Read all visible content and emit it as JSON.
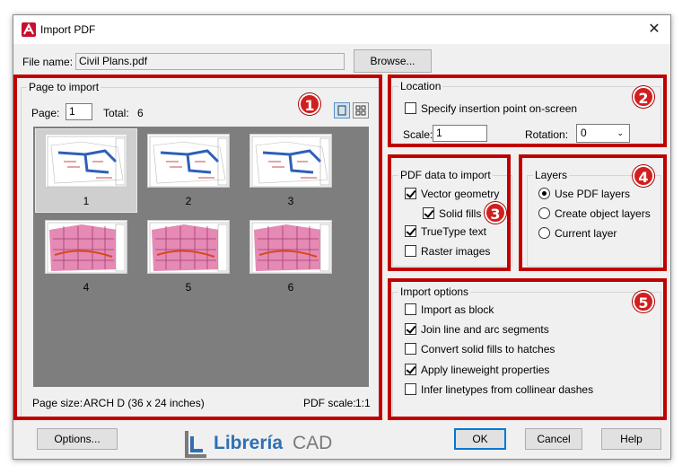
{
  "window": {
    "title": "Import PDF",
    "close_glyph": "✕"
  },
  "file": {
    "label": "File name:",
    "value": "Civil Plans.pdf",
    "browse": "Browse..."
  },
  "page_to_import": {
    "legend": "Page to import",
    "page_label": "Page:",
    "page_value": "1",
    "total_label": "Total:",
    "total_value": "6",
    "thumbnails": [
      "1",
      "2",
      "3",
      "4",
      "5",
      "6"
    ],
    "page_size_label": "Page size:",
    "page_size_value": "ARCH D (36 x 24 inches)",
    "pdf_scale_label": "PDF scale:",
    "pdf_scale_value": "1:1"
  },
  "location": {
    "legend": "Location",
    "specify_label": "Specify insertion point on-screen",
    "specify_checked": false,
    "scale_label": "Scale:",
    "scale_value": "1",
    "rotation_label": "Rotation:",
    "rotation_value": "0"
  },
  "pdf_data": {
    "legend": "PDF data to import",
    "vector": "Vector geometry",
    "solid_fills": "Solid fills",
    "truetype": "TrueType text",
    "raster": "Raster images"
  },
  "layers": {
    "legend": "Layers",
    "use_pdf": "Use PDF layers",
    "create_object": "Create object layers",
    "current": "Current layer"
  },
  "import_options": {
    "legend": "Import options",
    "as_block": "Import as block",
    "join": "Join line and arc segments",
    "convert": "Convert solid fills to hatches",
    "lineweight": "Apply lineweight properties",
    "infer": "Infer linetypes from collinear dashes"
  },
  "footer": {
    "options": "Options...",
    "ok": "OK",
    "cancel": "Cancel",
    "help": "Help"
  },
  "logo": {
    "text1": "Librería",
    "text2": "CAD"
  },
  "badges": [
    "1",
    "2",
    "3",
    "4",
    "5"
  ],
  "colors": {
    "annotation_red": "#c00000",
    "badge_red": "#d11f1f",
    "default_button_border": "#0078d7",
    "logo_blue": "#2f6fb3",
    "logo_gray": "#7a7a7a"
  }
}
